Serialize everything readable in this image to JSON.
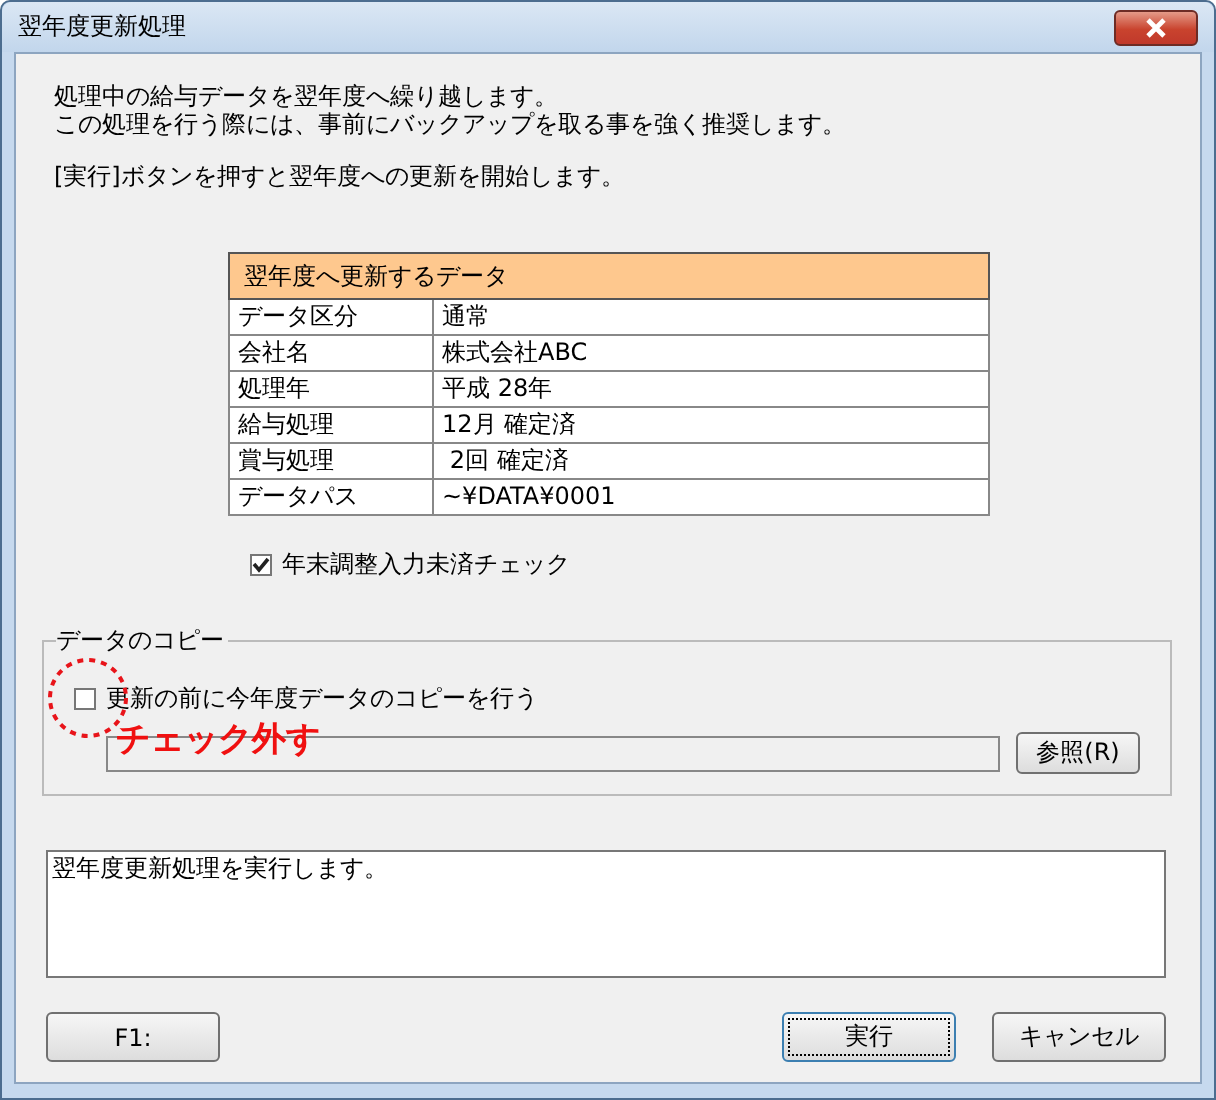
{
  "window": {
    "title": "翌年度更新処理"
  },
  "intro": [
    "処理中の給与データを翌年度へ繰り越します。",
    "この処理を行う際には、事前にバックアップを取る事を強く推奨します。"
  ],
  "instruction": "[実行]ボタンを押すと翌年度への更新を開始します。",
  "table": {
    "header": "翌年度へ更新するデータ",
    "rows": [
      {
        "label": "データ区分",
        "value": "通常"
      },
      {
        "label": "会社名",
        "value": "株式会社ABC"
      },
      {
        "label": "処理年",
        "value": "平成 28年"
      },
      {
        "label": "給与処理",
        "value": "12月 確定済"
      },
      {
        "label": "賞与処理",
        "value": " 2回 確定済"
      },
      {
        "label": "データパス",
        "value": "~¥DATA¥0001"
      }
    ]
  },
  "year_end_check": {
    "label": "年末調整入力未済チェック",
    "checked": true
  },
  "copy_group": {
    "legend": "データのコピー",
    "checkbox": {
      "label": "更新の前に今年度データのコピーを行う",
      "checked": false
    },
    "browse_button": "参照(R)"
  },
  "annotation": {
    "text": "チェック外す"
  },
  "message": "翌年度更新処理を実行します。",
  "buttons": [
    {
      "label": "F1:",
      "default": false
    },
    {
      "label": "実行",
      "default": true
    },
    {
      "label": "キャンセル",
      "default": false
    }
  ]
}
